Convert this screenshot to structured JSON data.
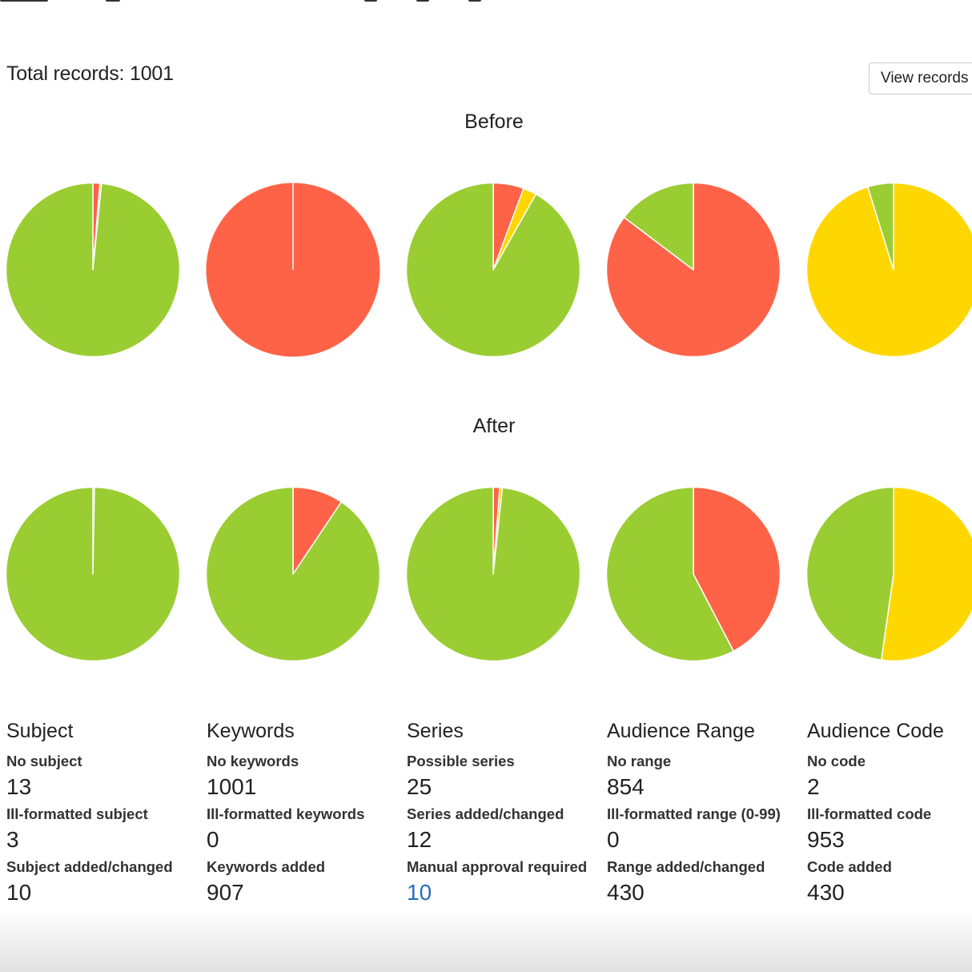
{
  "header": {
    "total_records": "Total records: 1001",
    "view_records_button": "View records"
  },
  "colors": {
    "ok": "#9ACD32",
    "problem": "#FF6347",
    "warning": "#FFD700"
  },
  "chart_data": {
    "type": "pie",
    "sections": [
      {
        "title": "Before",
        "pies": [
          {
            "name": "Subject",
            "slices": [
              {
                "color": "#FF6347",
                "value": 13
              },
              {
                "color": "#FFD700",
                "value": 3
              },
              {
                "color": "#9ACD32",
                "value": 985
              }
            ]
          },
          {
            "name": "Keywords",
            "slices": [
              {
                "color": "#FF6347",
                "value": 1001
              }
            ]
          },
          {
            "name": "Series",
            "slices": [
              {
                "color": "#FF6347",
                "value": 57
              },
              {
                "color": "#FFD700",
                "value": 25
              },
              {
                "color": "#9ACD32",
                "value": 919
              }
            ]
          },
          {
            "name": "Audience Range",
            "slices": [
              {
                "color": "#FF6347",
                "value": 854
              },
              {
                "color": "#9ACD32",
                "value": 147
              }
            ]
          },
          {
            "name": "Audience Code",
            "slices": [
              {
                "color": "#FFD700",
                "value": 953
              },
              {
                "color": "#9ACD32",
                "value": 48
              }
            ]
          }
        ]
      },
      {
        "title": "After",
        "pies": [
          {
            "name": "Subject",
            "slices": [
              {
                "color": "#FF6347",
                "value": 3
              },
              {
                "color": "#9ACD32",
                "value": 998
              }
            ]
          },
          {
            "name": "Keywords",
            "slices": [
              {
                "color": "#FF6347",
                "value": 94
              },
              {
                "color": "#9ACD32",
                "value": 907
              }
            ]
          },
          {
            "name": "Series",
            "slices": [
              {
                "color": "#FF6347",
                "value": 12
              },
              {
                "color": "#FFD700",
                "value": 5
              },
              {
                "color": "#9ACD32",
                "value": 984
              }
            ]
          },
          {
            "name": "Audience Range",
            "slices": [
              {
                "color": "#FF6347",
                "value": 424
              },
              {
                "color": "#9ACD32",
                "value": 577
              }
            ]
          },
          {
            "name": "Audience Code",
            "slices": [
              {
                "color": "#FFD700",
                "value": 523
              },
              {
                "color": "#9ACD32",
                "value": 478
              }
            ]
          }
        ]
      }
    ]
  },
  "stats": [
    {
      "title": "Subject",
      "items": [
        {
          "label": "No subject",
          "value": "13"
        },
        {
          "label": "Ill-formatted subject",
          "value": "3"
        },
        {
          "label": "Subject added/changed",
          "value": "10"
        }
      ]
    },
    {
      "title": "Keywords",
      "items": [
        {
          "label": "No keywords",
          "value": "1001"
        },
        {
          "label": "Ill-formatted keywords",
          "value": "0"
        },
        {
          "label": "Keywords added",
          "value": "907"
        }
      ]
    },
    {
      "title": "Series",
      "items": [
        {
          "label": "Possible series",
          "value": "25"
        },
        {
          "label": "Series added/changed",
          "value": "12"
        },
        {
          "label": "Manual approval required",
          "value": "10",
          "link": true
        }
      ]
    },
    {
      "title": "Audience Range",
      "items": [
        {
          "label": "No range",
          "value": "854"
        },
        {
          "label": "Ill-formatted range (0-99)",
          "value": "0"
        },
        {
          "label": "Range added/changed",
          "value": "430"
        }
      ]
    },
    {
      "title": "Audience Code",
      "items": [
        {
          "label": "No code",
          "value": "2"
        },
        {
          "label": "Ill-formatted code",
          "value": "953"
        },
        {
          "label": "Code added",
          "value": "430"
        }
      ]
    }
  ]
}
